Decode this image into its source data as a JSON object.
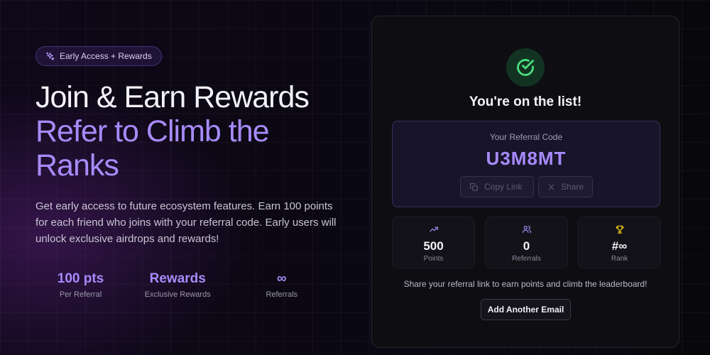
{
  "hero": {
    "badge": "Early Access + Rewards",
    "headline_line1": "Join & Earn Rewards",
    "headline_line2": "Refer to Climb the Ranks",
    "description": "Get early access to future ecosystem features. Earn 100 points for each friend who joins with your referral code. Early users will unlock exclusive airdrops and rewards!",
    "stats": [
      {
        "value": "100 pts",
        "label": "Per Referral"
      },
      {
        "value": "Rewards",
        "label": "Exclusive Rewards"
      },
      {
        "value": "∞",
        "label": "Referrals"
      }
    ]
  },
  "card": {
    "title": "You're on the list!",
    "referral_label": "Your Referral Code",
    "referral_code": "U3M8MT",
    "copy_label": "Copy Link",
    "share_label": "Share",
    "stats": [
      {
        "icon": "trending-up-icon",
        "value": "500",
        "label": "Points"
      },
      {
        "icon": "users-icon",
        "value": "0",
        "label": "Referrals"
      },
      {
        "icon": "trophy-icon",
        "value": "#∞",
        "label": "Rank"
      }
    ],
    "share_text": "Share your referral link to earn points and climb the leaderboard!",
    "add_button": "Add Another Email"
  },
  "colors": {
    "accent": "#a78bfa",
    "success": "#4ade80",
    "trophy": "#facc15"
  }
}
